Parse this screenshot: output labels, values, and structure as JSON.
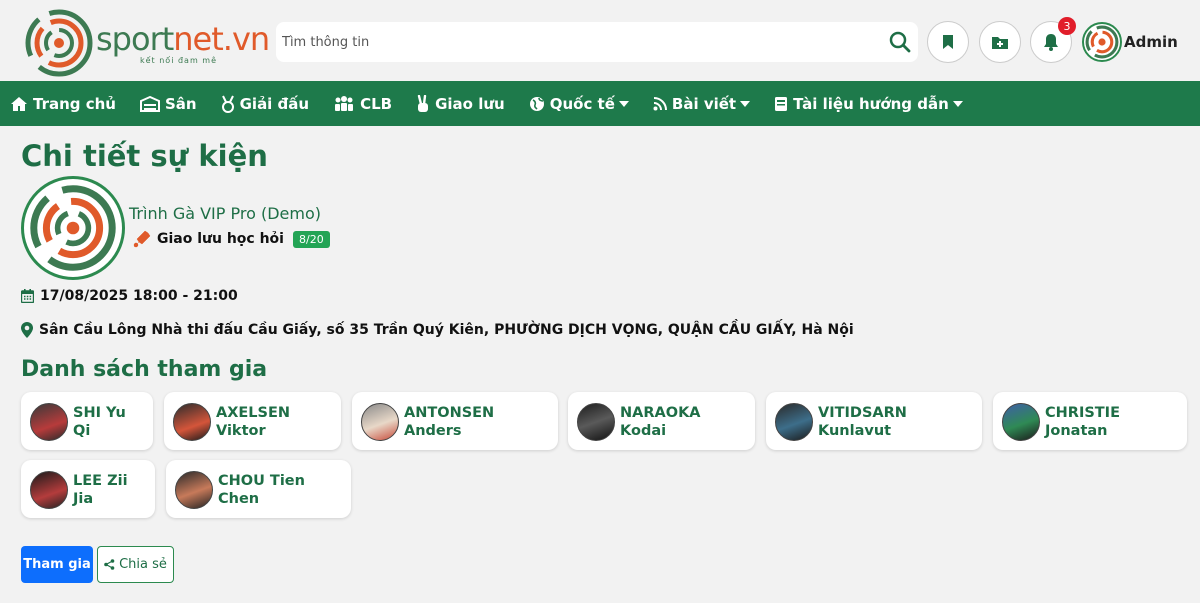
{
  "brand": {
    "name_part1": "sport",
    "name_part2": "net.vn",
    "tagline": "kết nối đam mê",
    "colors": {
      "green": "#1e7a4b",
      "orange": "#e05a2a"
    }
  },
  "search": {
    "placeholder": "Tìm thông tin",
    "value": ""
  },
  "header": {
    "bookmark_icon": "bookmark-icon",
    "add_icon": "folder-plus-icon",
    "notif_icon": "bell-icon",
    "notification_count": "3",
    "user_name": "Admin"
  },
  "nav": {
    "items": [
      {
        "label": "Trang chủ",
        "icon": "home-icon"
      },
      {
        "label": "Sân",
        "icon": "stadium-icon"
      },
      {
        "label": "Giải đấu",
        "icon": "medal-icon"
      },
      {
        "label": "CLB",
        "icon": "people-icon"
      },
      {
        "label": "Giao lưu",
        "icon": "hand-peace-icon"
      },
      {
        "label": "Quốc tế",
        "icon": "globe-icon",
        "dropdown": true
      },
      {
        "label": "Bài viết",
        "icon": "rss-icon",
        "dropdown": true
      },
      {
        "label": "Tài liệu hướng dẫn",
        "icon": "book-icon",
        "dropdown": true
      }
    ]
  },
  "event": {
    "page_title": "Chi tiết sự kiện",
    "name": "Trình Gà VIP Pro (Demo)",
    "type": "Giao lưu học hỏi",
    "slots": "8/20",
    "datetime": "17/08/2025 18:00 - 21:00",
    "location": "Sân Cầu Lông Nhà thi đấu Cầu Giấy, số 35 Trần Quý Kiên, PHƯỜNG DỊCH VỌNG, QUẬN CẦU GIẤY, Hà Nội"
  },
  "participants": {
    "title": "Danh sách tham gia",
    "players": [
      {
        "line1": "SHI Yu",
        "line2": "Qi"
      },
      {
        "line1": "AXELSEN",
        "line2": "Viktor"
      },
      {
        "line1": "ANTONSEN",
        "line2": "Anders"
      },
      {
        "line1": "NARAOKA",
        "line2": "Kodai"
      },
      {
        "line1": "VITIDSARN",
        "line2": "Kunlavut"
      },
      {
        "line1": "CHRISTIE",
        "line2": "Jonatan"
      },
      {
        "line1": "LEE Zii",
        "line2": "Jia"
      },
      {
        "line1": "CHOU Tien",
        "line2": "Chen"
      }
    ]
  },
  "actions": {
    "join_label": "Tham gia",
    "share_label": "Chia sẻ"
  }
}
